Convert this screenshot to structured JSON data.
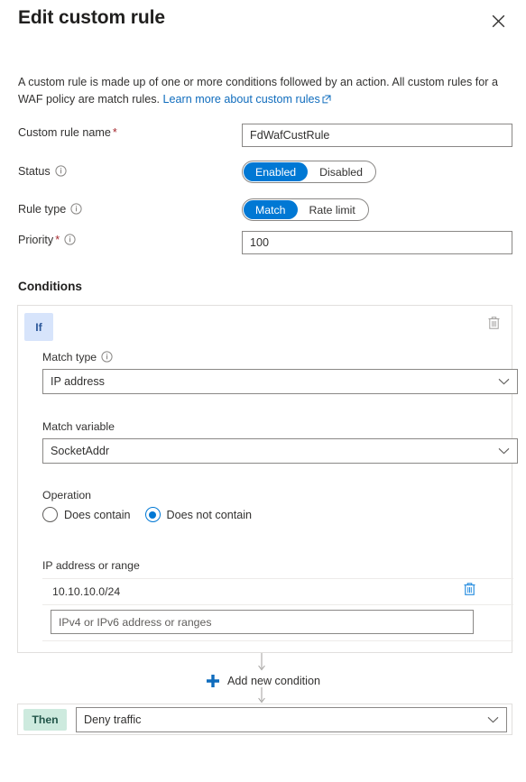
{
  "dialog": {
    "title": "Edit custom rule",
    "close_icon": "close-icon",
    "intro_text_1": "A custom rule is made up of one or more conditions followed by an action. All custom rules for a WAF policy are match rules. ",
    "intro_link": "Learn more about custom rules",
    "external_link_icon": "external-link-icon"
  },
  "form": {
    "rule_name": {
      "label": "Custom rule name",
      "required_marker": "*",
      "value": "FdWafCustRule"
    },
    "status": {
      "label": "Status",
      "info_icon": "info-icon",
      "options": [
        "Enabled",
        "Disabled"
      ],
      "selected": "Enabled"
    },
    "rule_type": {
      "label": "Rule type",
      "info_icon": "info-icon",
      "options": [
        "Match",
        "Rate limit"
      ],
      "selected": "Match"
    },
    "priority": {
      "label": "Priority",
      "required_marker": "*",
      "info_icon": "info-icon",
      "value": "100"
    }
  },
  "conditions": {
    "heading": "Conditions",
    "if_badge": "If",
    "delete_condition_icon": "trash-icon",
    "match_type": {
      "label": "Match type",
      "info_icon": "info-icon",
      "value": "IP address",
      "chevron_icon": "chevron-down-icon"
    },
    "match_variable": {
      "label": "Match variable",
      "value": "SocketAddr",
      "chevron_icon": "chevron-down-icon"
    },
    "operation": {
      "label": "Operation",
      "options": [
        "Does contain",
        "Does not contain"
      ],
      "selected": "Does not contain"
    },
    "ip_address": {
      "label": "IP address or range",
      "entries": [
        "10.10.10.0/24"
      ],
      "delete_entry_icon": "trash-icon",
      "new_entry_placeholder": "IPv4 or IPv6 address or ranges",
      "new_entry_value": ""
    }
  },
  "add_condition": {
    "icon": "plus-icon",
    "label": "Add new condition"
  },
  "action": {
    "then_badge": "Then",
    "value": "Deny traffic",
    "chevron_icon": "chevron-down-icon"
  },
  "colors": {
    "accent": "#0078d4",
    "link": "#0f6cbd",
    "required": "#a4262c",
    "if_badge_bg": "#d7e4fb",
    "then_badge_bg": "#cdeade",
    "trash_blue": "#2a8fe0"
  }
}
